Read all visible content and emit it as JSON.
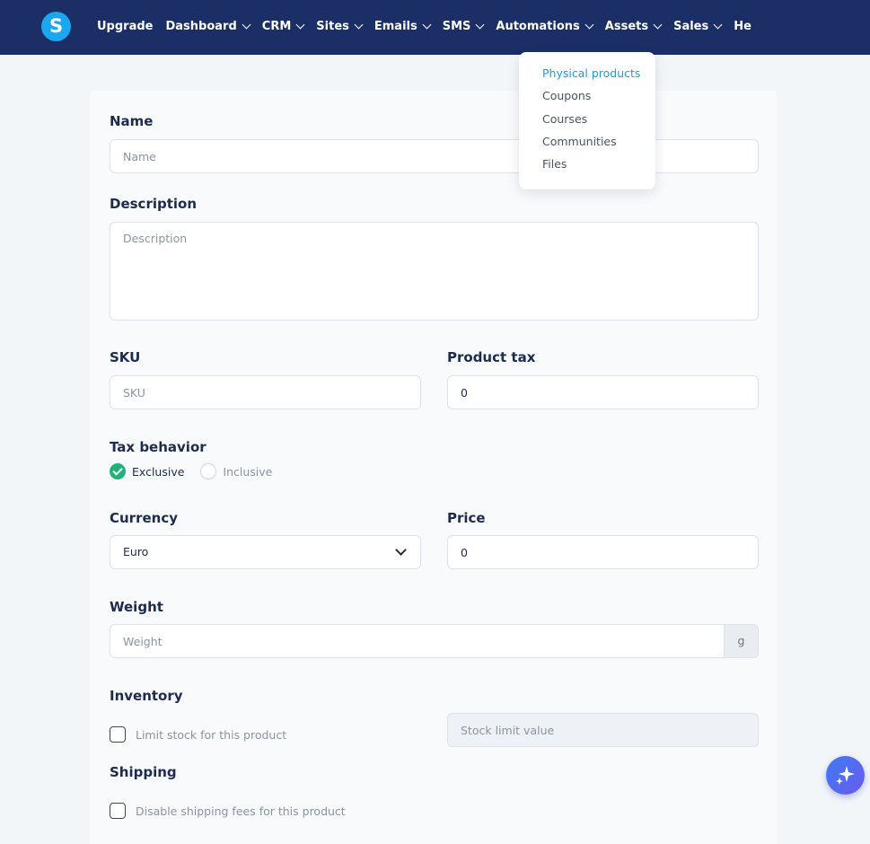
{
  "brand": {
    "logo_letter": "S"
  },
  "nav": [
    {
      "label": "Upgrade",
      "has_chevron": false
    },
    {
      "label": "Dashboard",
      "has_chevron": true
    },
    {
      "label": "CRM",
      "has_chevron": true
    },
    {
      "label": "Sites",
      "has_chevron": true
    },
    {
      "label": "Emails",
      "has_chevron": true
    },
    {
      "label": "SMS",
      "has_chevron": true
    },
    {
      "label": "Automations",
      "has_chevron": true
    },
    {
      "label": "Assets",
      "has_chevron": true
    },
    {
      "label": "Sales",
      "has_chevron": true
    },
    {
      "label": "He",
      "has_chevron": false
    }
  ],
  "assets_menu": [
    {
      "label": "Physical products",
      "active": true
    },
    {
      "label": "Coupons",
      "active": false
    },
    {
      "label": "Courses",
      "active": false
    },
    {
      "label": "Communities",
      "active": false
    },
    {
      "label": "Files",
      "active": false
    }
  ],
  "form": {
    "name": {
      "label": "Name",
      "placeholder": "Name",
      "value": ""
    },
    "description": {
      "label": "Description",
      "placeholder": "Description",
      "value": ""
    },
    "sku": {
      "label": "SKU",
      "placeholder": "SKU",
      "value": ""
    },
    "product_tax": {
      "label": "Product tax",
      "value": "0"
    },
    "tax_behavior": {
      "label": "Tax behavior",
      "options": [
        {
          "label": "Exclusive",
          "selected": true
        },
        {
          "label": "Inclusive",
          "selected": false
        }
      ]
    },
    "currency": {
      "label": "Currency",
      "value": "Euro"
    },
    "price": {
      "label": "Price",
      "value": "0"
    },
    "weight": {
      "label": "Weight",
      "placeholder": "Weight",
      "unit": "g"
    },
    "inventory": {
      "label": "Inventory",
      "checkbox_label": "Limit stock for this product",
      "checked": false,
      "stock_placeholder": "Stock limit value"
    },
    "shipping": {
      "label": "Shipping",
      "checkbox_label": "Disable shipping fees for this product",
      "checked": false
    }
  },
  "colors": {
    "topbar": "#1b2f66",
    "accent": "#1f9bd8",
    "success": "#1fb37a",
    "logo": "#1aa6f0"
  },
  "fab": {
    "icon": "sparkles-icon"
  }
}
